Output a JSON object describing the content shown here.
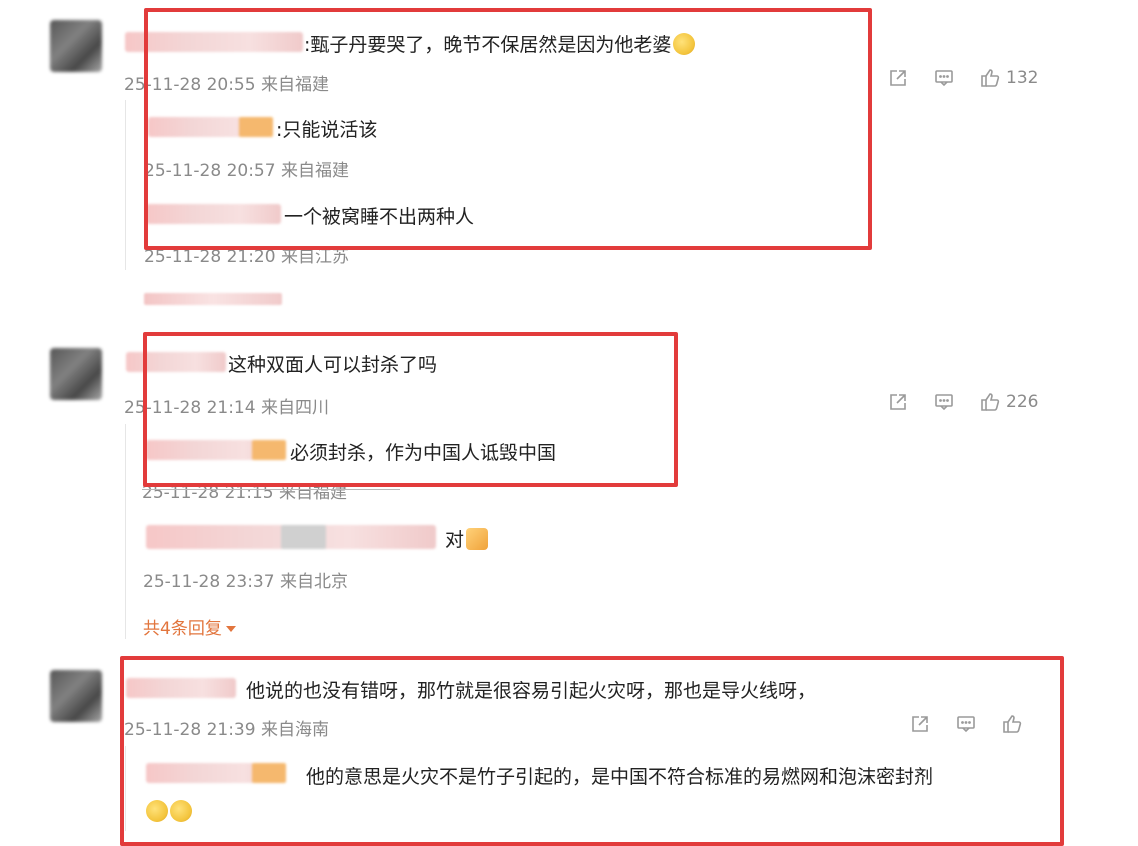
{
  "comments": [
    {
      "text": ":甄子丹要哭了，晚节不保居然是因为他老婆",
      "meta": "25-11-28 20:55 来自福建",
      "likes": "132",
      "replies": [
        {
          "text": ":只能说活该",
          "meta": "25-11-28 20:57 来自福建"
        },
        {
          "text": "一个被窝睡不出两种人",
          "meta": "25-11-28 21:20 来自江苏"
        }
      ]
    },
    {
      "text": "这种双面人可以封杀了吗",
      "meta": "25-11-28 21:14 来自四川",
      "likes": "226",
      "replies": [
        {
          "text": "必须封杀，作为中国人诋毁中国",
          "meta": "25-11-28 21:15 来自福建"
        },
        {
          "text": "对",
          "meta": "25-11-28 23:37 来自北京"
        }
      ],
      "more_replies": "共4条回复"
    },
    {
      "text": "他说的也没有错呀，那竹就是很容易引起火灾呀，那也是导火线呀，",
      "meta": "25-11-28 21:39 来自海南",
      "replies": [
        {
          "text": "他的意思是火灾不是竹子引起的，是中国不符合标准的易燃网和泡沫密封剂"
        }
      ]
    }
  ],
  "icons": {
    "share": "share-icon",
    "comment": "comment-icon",
    "like": "thumbs-up-icon"
  },
  "colors": {
    "highlight_box": "#e23b3b",
    "more_link": "#e2753d"
  }
}
